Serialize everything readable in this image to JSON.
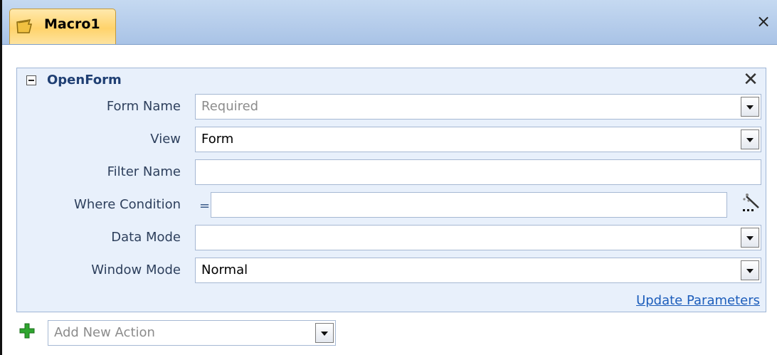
{
  "tab": {
    "title": "Macro1",
    "close_glyph": "×",
    "icon": "macro-icon"
  },
  "action": {
    "name": "OpenForm",
    "close_glyph": "✕",
    "params": {
      "form_name": {
        "label": "Form Name",
        "value": "",
        "placeholder": "Required"
      },
      "view": {
        "label": "View",
        "value": "Form"
      },
      "filter_name": {
        "label": "Filter Name",
        "value": ""
      },
      "where_condition": {
        "label": "Where Condition",
        "prefix": "=",
        "value": ""
      },
      "data_mode": {
        "label": "Data Mode",
        "value": ""
      },
      "window_mode": {
        "label": "Window Mode",
        "value": "Normal"
      }
    },
    "update_link": "Update Parameters"
  },
  "add_action": {
    "placeholder": "Add New Action",
    "icon": "plus-icon"
  },
  "colors": {
    "tab_active": "#ffd36b",
    "block_bg": "#e8f0fb",
    "link": "#1c5dbb",
    "title": "#1f3f73",
    "plus": "#2fa52f"
  }
}
